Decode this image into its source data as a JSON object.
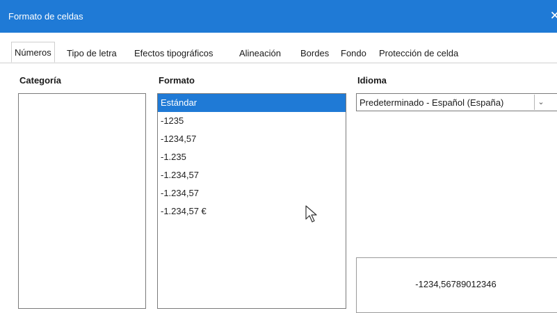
{
  "window": {
    "title": "Formato de celdas",
    "close_glyph": "✕"
  },
  "tabs": [
    {
      "label": "Números",
      "active": true
    },
    {
      "label": "Tipo de letra"
    },
    {
      "label": "Efectos tipográficos"
    },
    {
      "label": "Alineación"
    },
    {
      "label": "Bordes"
    },
    {
      "label": "Fondo"
    },
    {
      "label": "Protección de celda"
    }
  ],
  "category": {
    "label": "Categoría",
    "items": []
  },
  "format": {
    "label": "Formato",
    "items": [
      "Estándar",
      "-1235",
      "-1234,57",
      "-1.235",
      "-1.234,57",
      "-1.234,57",
      "-1.234,57 €"
    ],
    "selected_index": 0
  },
  "language": {
    "label": "Idioma",
    "value": "Predeterminado - Español (España)",
    "dropdown_glyph": "⌄"
  },
  "preview": {
    "value": "-1234,56789012346"
  },
  "colors": {
    "accent": "#1f7ad6"
  }
}
